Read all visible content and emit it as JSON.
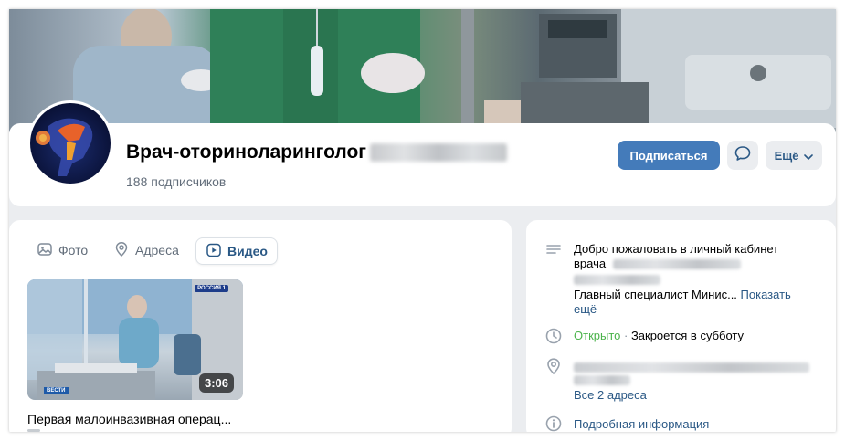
{
  "profile": {
    "title": "Врач-оториноларинголог",
    "subscribers": "188 подписчиков"
  },
  "actions": {
    "subscribe_label": "Подписаться",
    "more_label": "Ещё"
  },
  "tabs": [
    {
      "label": "Фото",
      "icon": "photo-icon"
    },
    {
      "label": "Адреса",
      "icon": "location-pin-icon"
    },
    {
      "label": "Видео",
      "icon": "video-icon",
      "active": true
    }
  ],
  "video": {
    "duration": "3:06",
    "title": "Первая малоинвазивная операц...",
    "channel_badge": "РОССИЯ 1",
    "lower_badge": "ВЕСТИ"
  },
  "info": {
    "description_line1": "Добро пожаловать в личный кабинет",
    "description_line2": "врача",
    "description_line3": "Главный специалист Минис...",
    "show_more": "Показать",
    "show_more_2": "ещё",
    "status_open": "Открыто",
    "status_sep": " · ",
    "status_close": "Закроется в субботу",
    "all_addresses": "Все 2 адреса",
    "more_info": "Подробная информация"
  },
  "colors": {
    "accent": "#447bba",
    "link": "#2a5885",
    "open_green": "#4bb34b",
    "secondary_text": "#626d7a",
    "page_bg": "#ebedf0"
  }
}
